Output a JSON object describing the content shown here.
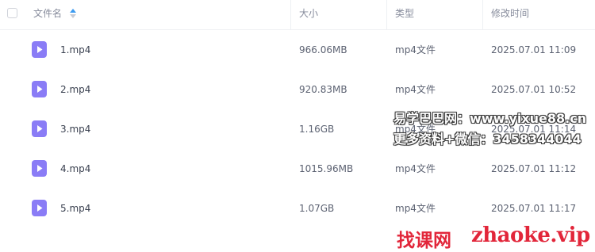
{
  "header": {
    "name_label": "文件名",
    "size_label": "大小",
    "type_label": "类型",
    "modified_label": "修改时间",
    "sort": "ascending"
  },
  "files": [
    {
      "name": "1.mp4",
      "size": "966.06MB",
      "type": "mp4文件",
      "modified": "2025.07.01 11:09"
    },
    {
      "name": "2.mp4",
      "size": "920.83MB",
      "type": "mp4文件",
      "modified": "2025.07.01 10:52"
    },
    {
      "name": "3.mp4",
      "size": "1.16GB",
      "type": "mp4文件",
      "modified": "2025.07.01 11:14"
    },
    {
      "name": "4.mp4",
      "size": "1015.96MB",
      "type": "mp4文件",
      "modified": "2025.07.01 11:12"
    },
    {
      "name": "5.mp4",
      "size": "1.07GB",
      "type": "mp4文件",
      "modified": "2025.07.01 11:17"
    }
  ],
  "watermark": {
    "line1": "易学巴巴网：www.yixue88.cn",
    "line2": "更多资料+微信：3458344044",
    "logo": "找课网",
    "url": "zhaoke.vip"
  },
  "colors": {
    "file_icon": "#8a7cf6",
    "sort_active": "#3d9bf0",
    "watermark_red": "#e2263a"
  },
  "icons": {
    "file": "video-file-icon",
    "sort": "sort-arrows-icon"
  }
}
